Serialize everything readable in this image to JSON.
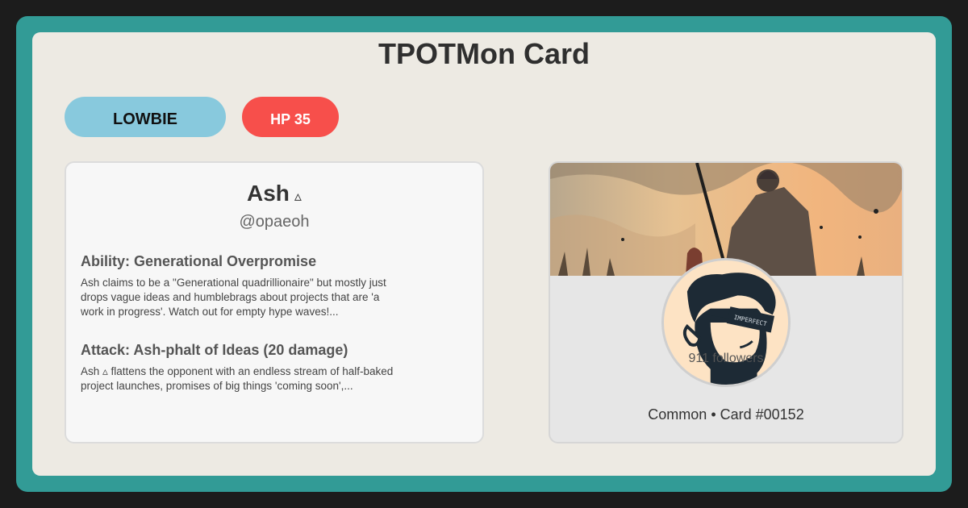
{
  "card": {
    "title": "TPOTMon Card",
    "type_label": "LOWBIE",
    "hp_label": "HP 35",
    "name": "Ash",
    "name_symbol": "▵",
    "handle": "@opaeoh",
    "ability": {
      "title": "Ability: Generational Overpromise",
      "text": "Ash claims to be a \"Generational quadrillionaire\" but mostly just drops vague ideas and humblebrags about projects that are 'a work in progress'. Watch out for empty hype waves!..."
    },
    "attack": {
      "title": "Attack: Ash-phalt of Ideas (20 damage)",
      "text": "Ash ▵ flattens the opponent with an endless stream of half-baked project launches, promises of big things 'coming soon',..."
    },
    "profile": {
      "followers": "911 followers",
      "avatar_text": "IMPERFECT",
      "footer": "Common • Card #00152"
    }
  },
  "colors": {
    "frame": "#329b96",
    "background": "#edeae3",
    "type_pill": "#88c9dd",
    "hp_pill": "#f74f4b"
  }
}
